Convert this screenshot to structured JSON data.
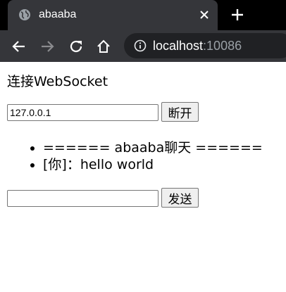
{
  "browser": {
    "tab_title": "abaaba",
    "url_host": "localhost",
    "url_port": ":10086"
  },
  "page": {
    "heading": "连接WebSocket",
    "address_value": "127.0.0.1",
    "disconnect_label": "断开",
    "messages": [
      "====== abaaba聊天 ======",
      "[你]：hello world"
    ],
    "message_input_value": "",
    "send_label": "发送"
  }
}
